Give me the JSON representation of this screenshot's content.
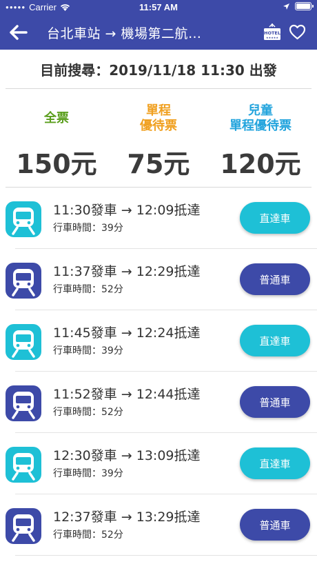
{
  "status_bar": {
    "carrier": "Carrier",
    "time": "11:57 AM"
  },
  "nav": {
    "title": "台北車站 → 機場第二航…",
    "hotel_label": "HOTEL"
  },
  "search": {
    "label": "目前搜尋：2019/11/18 11:30 出發"
  },
  "fares": [
    {
      "label_line1": "全票",
      "label_line2": "",
      "price": "150元",
      "color": "#5a9e1c"
    },
    {
      "label_line1": "單程",
      "label_line2": "優待票",
      "price": "75元",
      "color": "#f0a020"
    },
    {
      "label_line1": "兒童",
      "label_line2": "單程優待票",
      "price": "120元",
      "color": "#23a4dd"
    }
  ],
  "colors": {
    "primary": "#3d4aa8",
    "express": "#1ec0d6",
    "regular": "#3d4aa8"
  },
  "trains": [
    {
      "times": "11:30發車 → 12:09抵達",
      "duration": "行車時間：39分",
      "type": "直達車",
      "kind": "express"
    },
    {
      "times": "11:37發車 → 12:29抵達",
      "duration": "行車時間：52分",
      "type": "普通車",
      "kind": "regular"
    },
    {
      "times": "11:45發車 → 12:24抵達",
      "duration": "行車時間：39分",
      "type": "直達車",
      "kind": "express"
    },
    {
      "times": "11:52發車 → 12:44抵達",
      "duration": "行車時間：52分",
      "type": "普通車",
      "kind": "regular"
    },
    {
      "times": "12:30發車 → 13:09抵達",
      "duration": "行車時間：39分",
      "type": "直達車",
      "kind": "express"
    },
    {
      "times": "12:37發車 → 13:29抵達",
      "duration": "行車時間：52分",
      "type": "普通車",
      "kind": "regular"
    }
  ]
}
